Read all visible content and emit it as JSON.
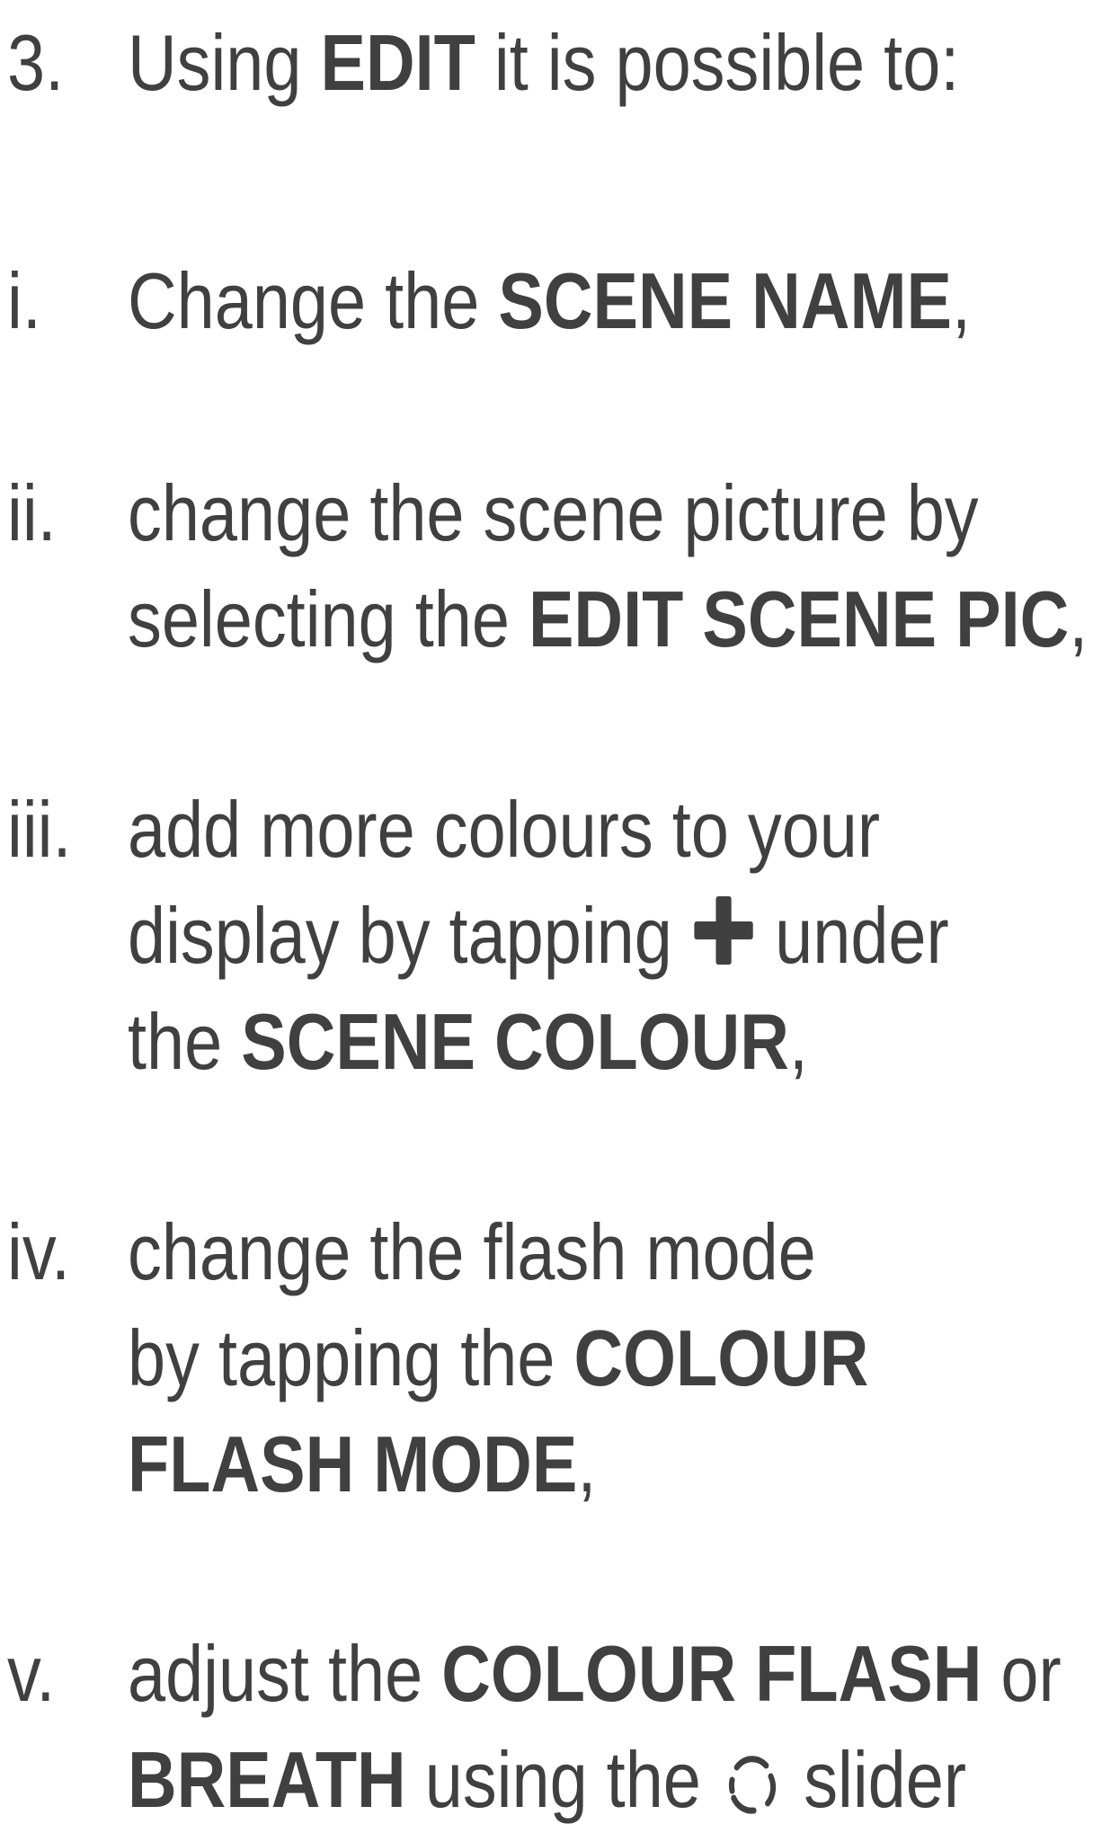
{
  "theme": {
    "text_color": "#404040",
    "background": "#ffffff"
  },
  "intro": {
    "number": "3.",
    "prefix": "Using ",
    "edit_label": "EDIT",
    "suffix": " it is possible to:"
  },
  "items": [
    {
      "marker": "i.",
      "lines": [
        {
          "t1": "Change the ",
          "b1": "SCENE NAME",
          "t2": ","
        }
      ]
    },
    {
      "marker": "ii.",
      "lines": [
        {
          "t1": "change the scene picture by"
        },
        {
          "t1": "selecting the ",
          "b1": "EDIT SCENE PIC",
          "t2": ","
        }
      ]
    },
    {
      "marker": "iii.",
      "lines": [
        {
          "t1": "add more colours to your"
        },
        {
          "t1": "display by tapping",
          "icon": "plus-icon",
          "t2": " under"
        },
        {
          "t1": "the ",
          "b1": "SCENE COLOUR",
          "t2": ","
        }
      ]
    },
    {
      "marker": "iv.",
      "lines": [
        {
          "t1": "change the flash mode"
        },
        {
          "t1": "by tapping the ",
          "b1": "COLOUR"
        },
        {
          "b1": "FLASH MODE",
          "t2": ","
        }
      ]
    },
    {
      "marker": "v.",
      "lines": [
        {
          "t1": "adjust the ",
          "b1": "COLOUR FLASH",
          "t2": " or"
        },
        {
          "b1": "BREATH",
          "t2": " using the",
          "icon": "slider-dial-icon",
          "t3": " slider"
        }
      ]
    }
  ]
}
